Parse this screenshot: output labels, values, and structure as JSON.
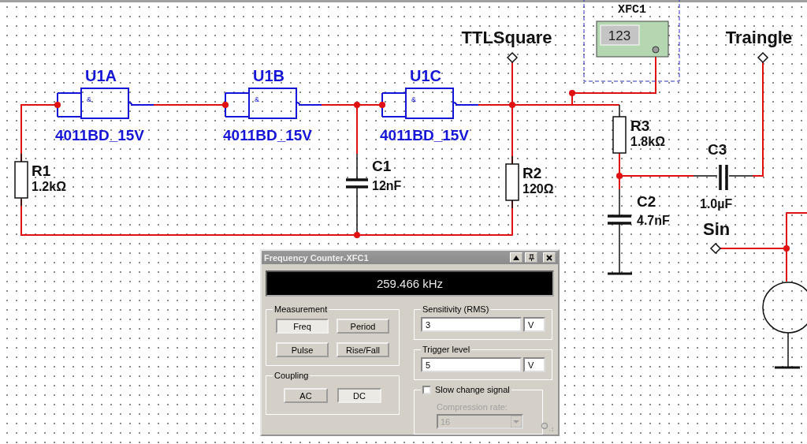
{
  "schematic": {
    "gates": [
      {
        "ref": "U1A",
        "model": "4011BD_15V",
        "symbol": "&"
      },
      {
        "ref": "U1B",
        "model": "4011BD_15V",
        "symbol": "&"
      },
      {
        "ref": "U1C",
        "model": "4011BD_15V",
        "symbol": "&"
      }
    ],
    "resistors": [
      {
        "ref": "R1",
        "value": "1.2kΩ"
      },
      {
        "ref": "R2",
        "value": "120Ω"
      },
      {
        "ref": "R3",
        "value": "1.8kΩ"
      }
    ],
    "capacitors": [
      {
        "ref": "C1",
        "value": "12nF"
      },
      {
        "ref": "C2",
        "value": "4.7nF"
      },
      {
        "ref": "C3",
        "value": "1.0µF"
      }
    ],
    "probes": [
      {
        "label": "TTLSquare"
      },
      {
        "label": "Traingle"
      },
      {
        "label": "Sin"
      }
    ],
    "instrument": {
      "ref": "XFC1",
      "display": "123"
    }
  },
  "dialog": {
    "title": "Frequency Counter-XFC1",
    "reading": "259.466 kHz",
    "measurement": {
      "title": "Measurement",
      "buttons": [
        {
          "label": "Freq",
          "selected": true
        },
        {
          "label": "Period",
          "selected": false
        },
        {
          "label": "Pulse",
          "selected": false
        },
        {
          "label": "Rise/Fall",
          "selected": false
        }
      ]
    },
    "coupling": {
      "title": "Coupling",
      "buttons": [
        {
          "label": "AC",
          "selected": false
        },
        {
          "label": "DC",
          "selected": true
        }
      ]
    },
    "sensitivity": {
      "title": "Sensitivity (RMS)",
      "value": "3",
      "unit": "V"
    },
    "trigger": {
      "title": "Trigger level",
      "value": "5",
      "unit": "V"
    },
    "slow_change": {
      "label": "Slow change signal",
      "checked": false
    },
    "compression": {
      "label": "Compression rate:",
      "value": "16",
      "disabled": true
    }
  }
}
